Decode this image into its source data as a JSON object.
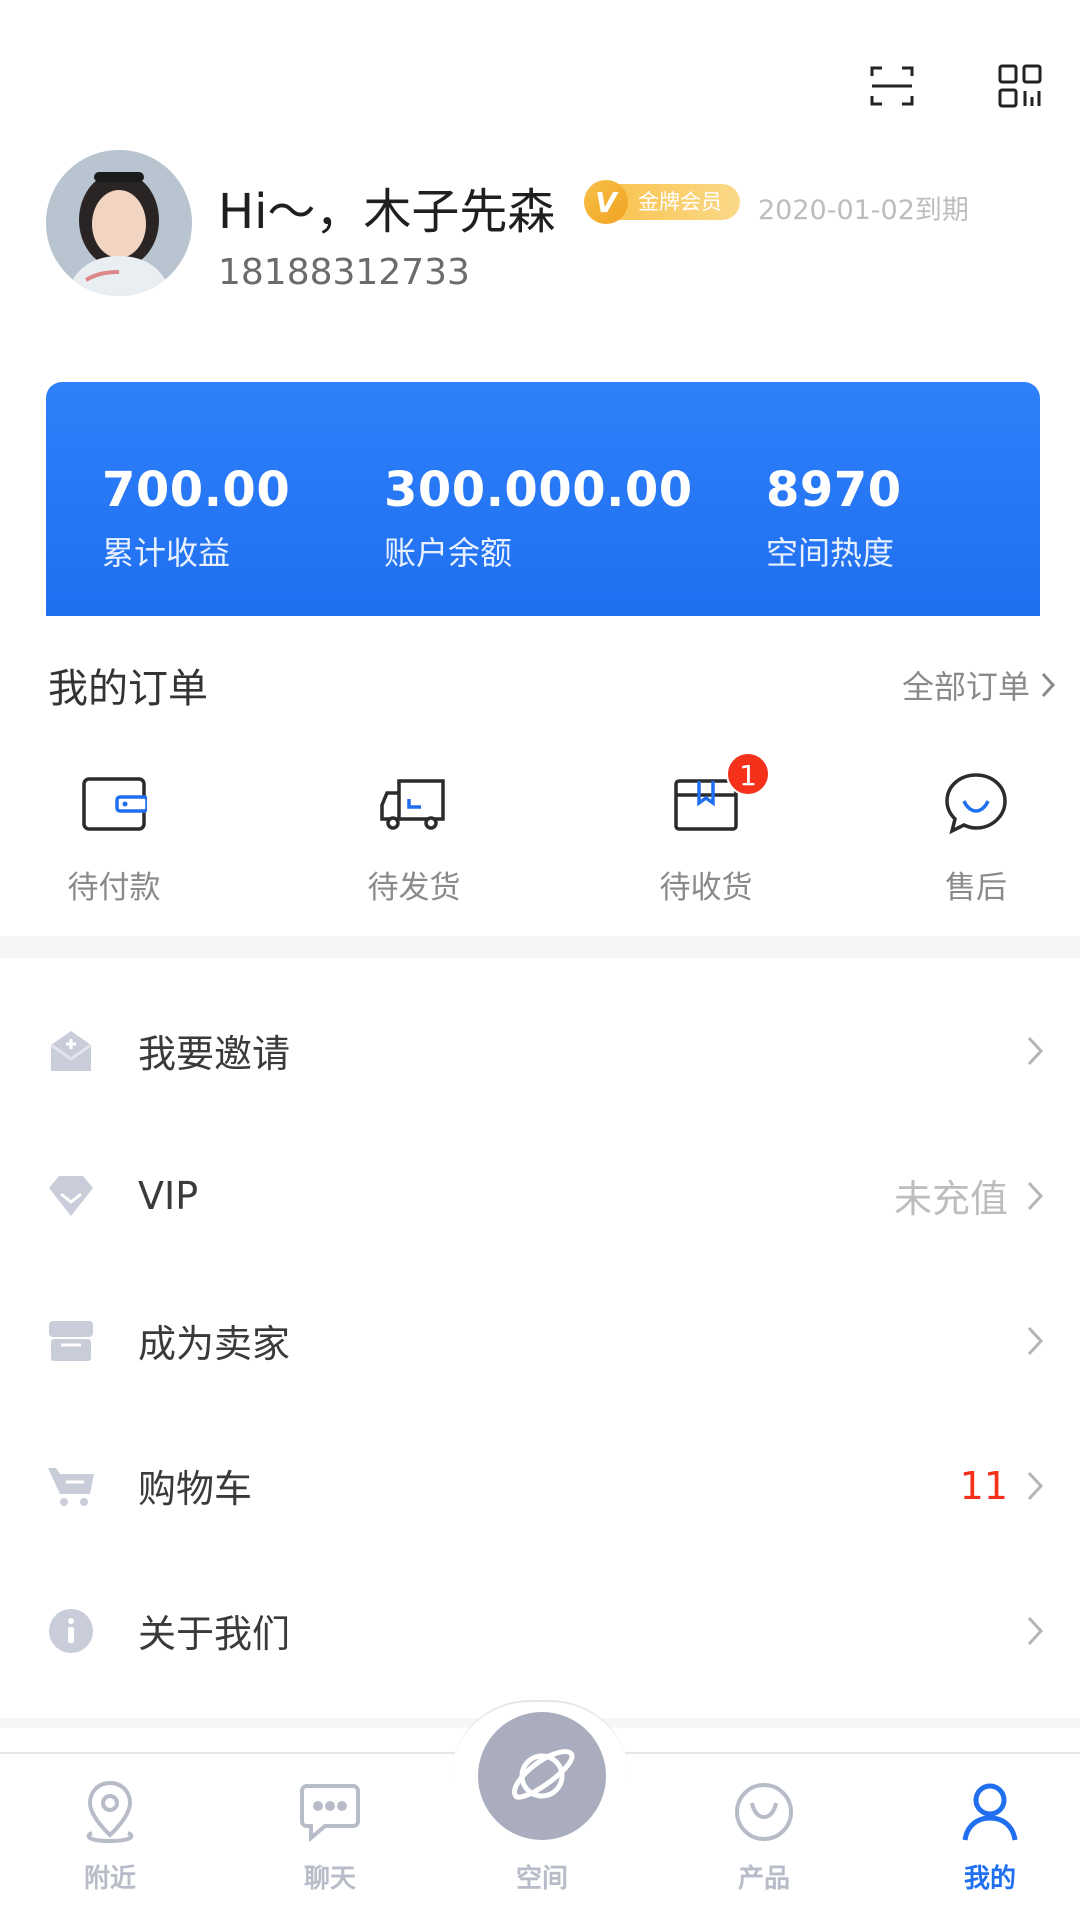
{
  "topbar": {
    "scan_icon": "scan-icon",
    "qr_icon": "qr-code-icon"
  },
  "profile": {
    "greeting": "Hi～，木子先森",
    "member_badge": "金牌会员",
    "member_v": "V",
    "expire": "2020-01-02到期",
    "phone": "18188312733"
  },
  "stats": [
    {
      "value": "700.00",
      "label": "累计收益"
    },
    {
      "value": "300.000.00",
      "label": "账户余额"
    },
    {
      "value": "8970",
      "label": "空间热度"
    }
  ],
  "orders": {
    "title": "我的订单",
    "all_label": "全部订单",
    "items": [
      {
        "label": "待付款",
        "icon": "wallet-icon"
      },
      {
        "label": "待发货",
        "icon": "truck-icon"
      },
      {
        "label": "待收货",
        "icon": "package-icon",
        "badge": "1"
      },
      {
        "label": "售后",
        "icon": "chat-smile-icon"
      }
    ]
  },
  "menu": [
    {
      "label": "我要邀请",
      "icon": "invite-mail-icon",
      "value": ""
    },
    {
      "label": "VIP",
      "icon": "diamond-icon",
      "value": "未充值"
    },
    {
      "label": "成为卖家",
      "icon": "store-icon",
      "value": ""
    },
    {
      "label": "购物车",
      "icon": "cart-icon",
      "value": "11"
    },
    {
      "label": "关于我们",
      "icon": "info-icon",
      "value": ""
    }
  ],
  "tabbar": [
    {
      "label": "附近",
      "icon": "location-icon"
    },
    {
      "label": "聊天",
      "icon": "chat-icon"
    },
    {
      "label": "空间",
      "icon": "planet-icon"
    },
    {
      "label": "产品",
      "icon": "bag-icon"
    },
    {
      "label": "我的",
      "icon": "user-icon",
      "active": true
    }
  ],
  "colors": {
    "primary": "#1f6ff0",
    "badge_red": "#f5311c",
    "gold": "#f9c451"
  }
}
